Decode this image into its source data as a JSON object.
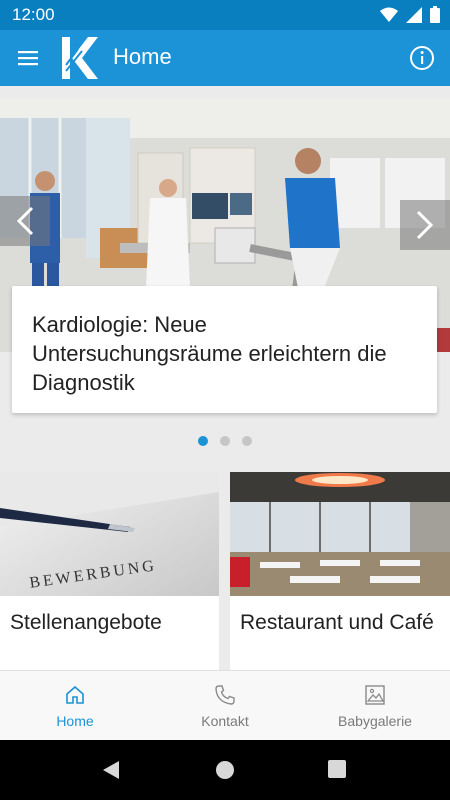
{
  "status_bar": {
    "time": "12:00"
  },
  "app_bar": {
    "title": "Home"
  },
  "carousel": {
    "slides": [
      {
        "caption": "Kardiologie: Neue Untersuchungsräume erleichtern die Diagnostik"
      }
    ],
    "active_index": 0,
    "dot_count": 3
  },
  "tiles": [
    {
      "label": "Stellenangebote",
      "image_text": "BEWERBUNG"
    },
    {
      "label": "Restaurant und Café"
    }
  ],
  "bottom_nav": {
    "items": [
      {
        "label": "Home",
        "icon": "home-icon",
        "active": true
      },
      {
        "label": "Kontakt",
        "icon": "phone-icon",
        "active": false
      },
      {
        "label": "Babygalerie",
        "icon": "image-icon",
        "active": false
      }
    ]
  },
  "colors": {
    "primary": "#1b93d6",
    "status_bar": "#0a7fc0"
  }
}
